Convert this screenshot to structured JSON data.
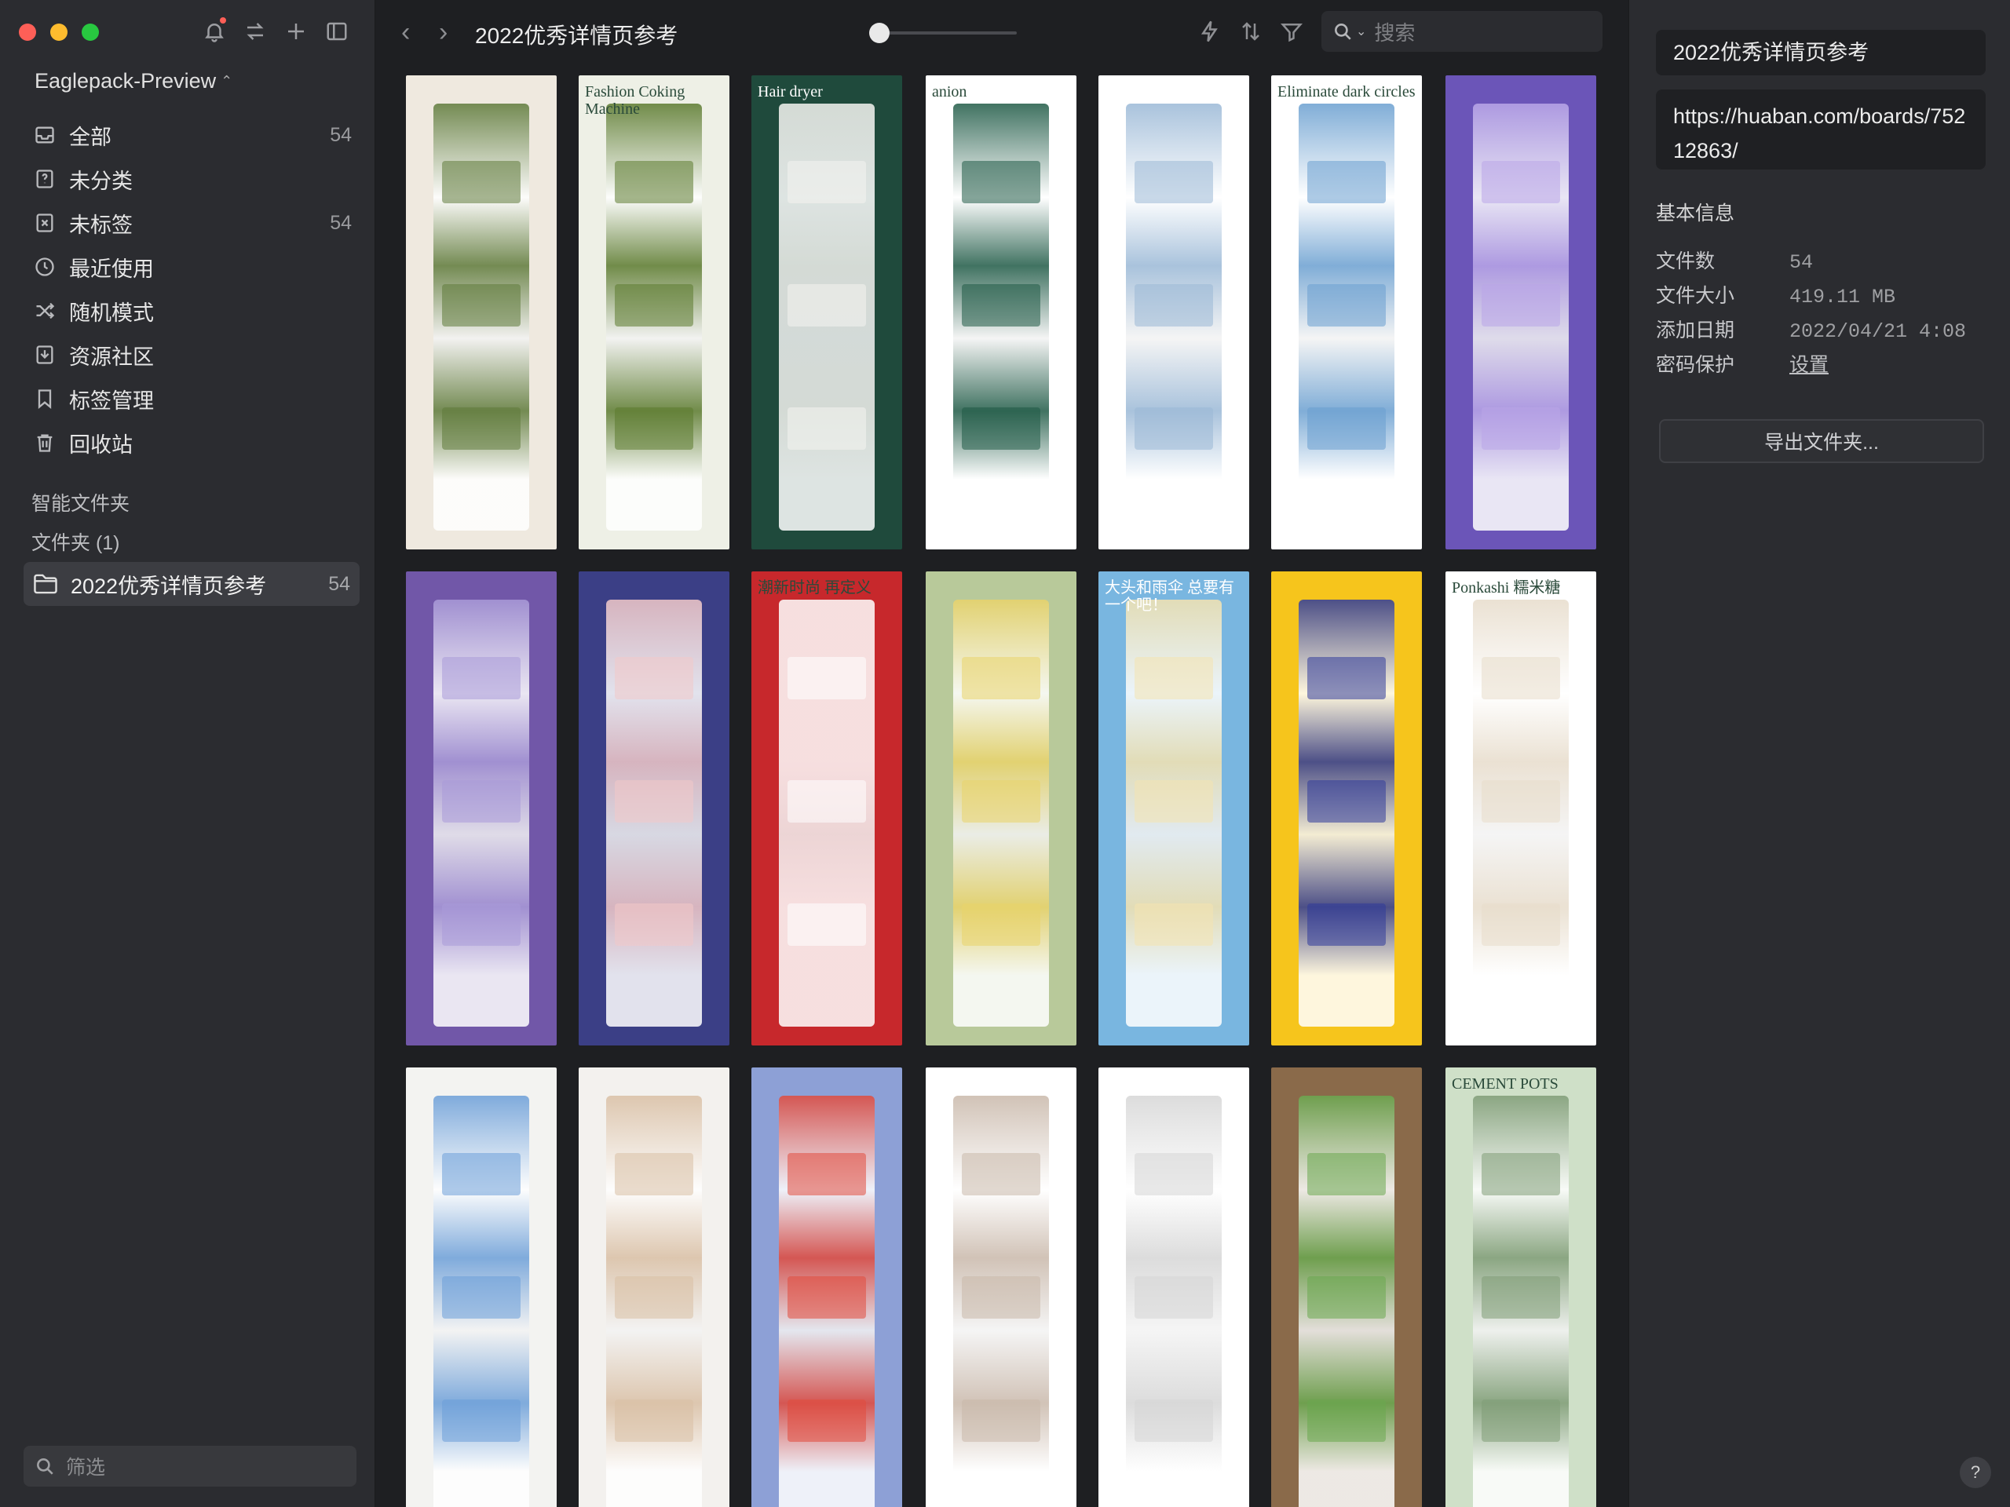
{
  "sidebar": {
    "library_name": "Eaglepack-Preview",
    "nav": [
      {
        "label": "全部",
        "count": "54",
        "icon": "inbox-icon"
      },
      {
        "label": "未分类",
        "count": "",
        "icon": "unknown-icon"
      },
      {
        "label": "未标签",
        "count": "54",
        "icon": "untagged-icon"
      },
      {
        "label": "最近使用",
        "count": "",
        "icon": "clock-icon"
      },
      {
        "label": "随机模式",
        "count": "",
        "icon": "shuffle-icon"
      },
      {
        "label": "资源社区",
        "count": "",
        "icon": "download-icon"
      },
      {
        "label": "标签管理",
        "count": "",
        "icon": "bookmark-icon"
      },
      {
        "label": "回收站",
        "count": "",
        "icon": "trash-icon"
      }
    ],
    "smart_folders_title": "智能文件夹",
    "folders_title": "文件夹 (1)",
    "folder": {
      "label": "2022优秀详情页参考",
      "count": "54"
    },
    "filter_placeholder": "筛选"
  },
  "toolbar": {
    "title": "2022优秀详情页参考",
    "back": "‹",
    "forward": "›",
    "search_placeholder": "搜索",
    "zoom_level": 0.0
  },
  "grid": {
    "thumbnails": [
      {
        "bg": "#efe9df",
        "accent": "#5e7a3a",
        "text": ""
      },
      {
        "bg": "#eef0e6",
        "accent": "#5b7a2e",
        "text": "Fashion Coking Machine"
      },
      {
        "bg": "#1f4a3c",
        "accent": "#f4f4f0",
        "text": "Hair dryer"
      },
      {
        "bg": "#ffffff",
        "accent": "#1f5a46",
        "text": "anion"
      },
      {
        "bg": "#ffffff",
        "accent": "#9ab8d6",
        "text": ""
      },
      {
        "bg": "#ffffff",
        "accent": "#6a9fd0",
        "text": "Eliminate dark circles"
      },
      {
        "bg": "#6b55b8",
        "accent": "#b9a6e8",
        "text": ""
      },
      {
        "bg": "#7157a8",
        "accent": "#a99ad8",
        "text": ""
      },
      {
        "bg": "#3b3f86",
        "accent": "#f2c9c9",
        "text": ""
      },
      {
        "bg": "#c7282c",
        "accent": "#ffffff",
        "text": "潮新时尚 再定义"
      },
      {
        "bg": "#b8c99a",
        "accent": "#e9d36a",
        "text": ""
      },
      {
        "bg": "#79b6e0",
        "accent": "#f4e3b0",
        "text": "大头和雨伞 总要有一个吧！"
      },
      {
        "bg": "#f6c51c",
        "accent": "#2f3b9a",
        "text": ""
      },
      {
        "bg": "#ffffff",
        "accent": "#e7dccb",
        "text": "Ponkashi 糯米糖"
      },
      {
        "bg": "#f3f3f1",
        "accent": "#6b9ed8",
        "text": ""
      },
      {
        "bg": "#f3f1ee",
        "accent": "#d9bfa4",
        "text": ""
      },
      {
        "bg": "#8da0d6",
        "accent": "#e14a3c",
        "text": ""
      },
      {
        "bg": "#ffffff",
        "accent": "#c9b8aa",
        "text": ""
      },
      {
        "bg": "#ffffff",
        "accent": "#d6d6d6",
        "text": ""
      },
      {
        "bg": "#8a6a4a",
        "accent": "#6aa84f",
        "text": ""
      },
      {
        "bg": "#cfe0c8",
        "accent": "#7f9c76",
        "text": "CEMENT POTS"
      }
    ]
  },
  "inspector": {
    "name": "2022优秀详情页参考",
    "url": "https://huaban.com/boards/75212863/",
    "info_title": "基本信息",
    "rows": [
      {
        "key": "文件数",
        "value": "54"
      },
      {
        "key": "文件大小",
        "value": "419.11 MB"
      },
      {
        "key": "添加日期",
        "value": "2022/04/21 4:08"
      },
      {
        "key": "密码保护",
        "value": "设置"
      }
    ],
    "export_label": "导出文件夹...",
    "help": "?"
  }
}
